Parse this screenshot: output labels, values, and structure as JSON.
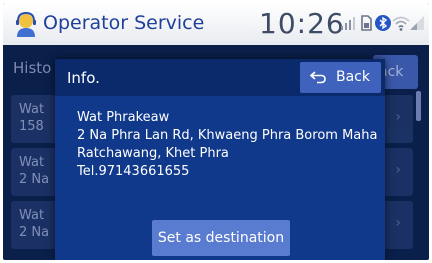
{
  "header": {
    "title": "Operator Service",
    "clock": "10:26",
    "status_icons": [
      "signal-bars-icon",
      "sim-icon",
      "bluetooth-icon",
      "wifi-icon"
    ]
  },
  "background": {
    "tab_label": "Histo",
    "back_label": "ack",
    "rows": [
      {
        "line1": "Wat",
        "line2": "158"
      },
      {
        "line1": "Wat",
        "line2": "2 Na"
      },
      {
        "line1": "Wat",
        "line2": "2 Na"
      }
    ]
  },
  "dialog": {
    "title": "Info.",
    "back_label": "Back",
    "place_name": "Wat Phrakeaw",
    "address_line1": "2 Na Phra Lan Rd, Khwaeng Phra Borom Maha",
    "address_line2": "Ratchawang, Khet Phra",
    "phone": "Tel.97143661655",
    "destination_button": "Set as destination"
  },
  "colors": {
    "screen_bg": "#0a1f4a",
    "dialog_bg": "#10398c",
    "button": "#3f63bd",
    "title_text": "#1f3f9a"
  }
}
